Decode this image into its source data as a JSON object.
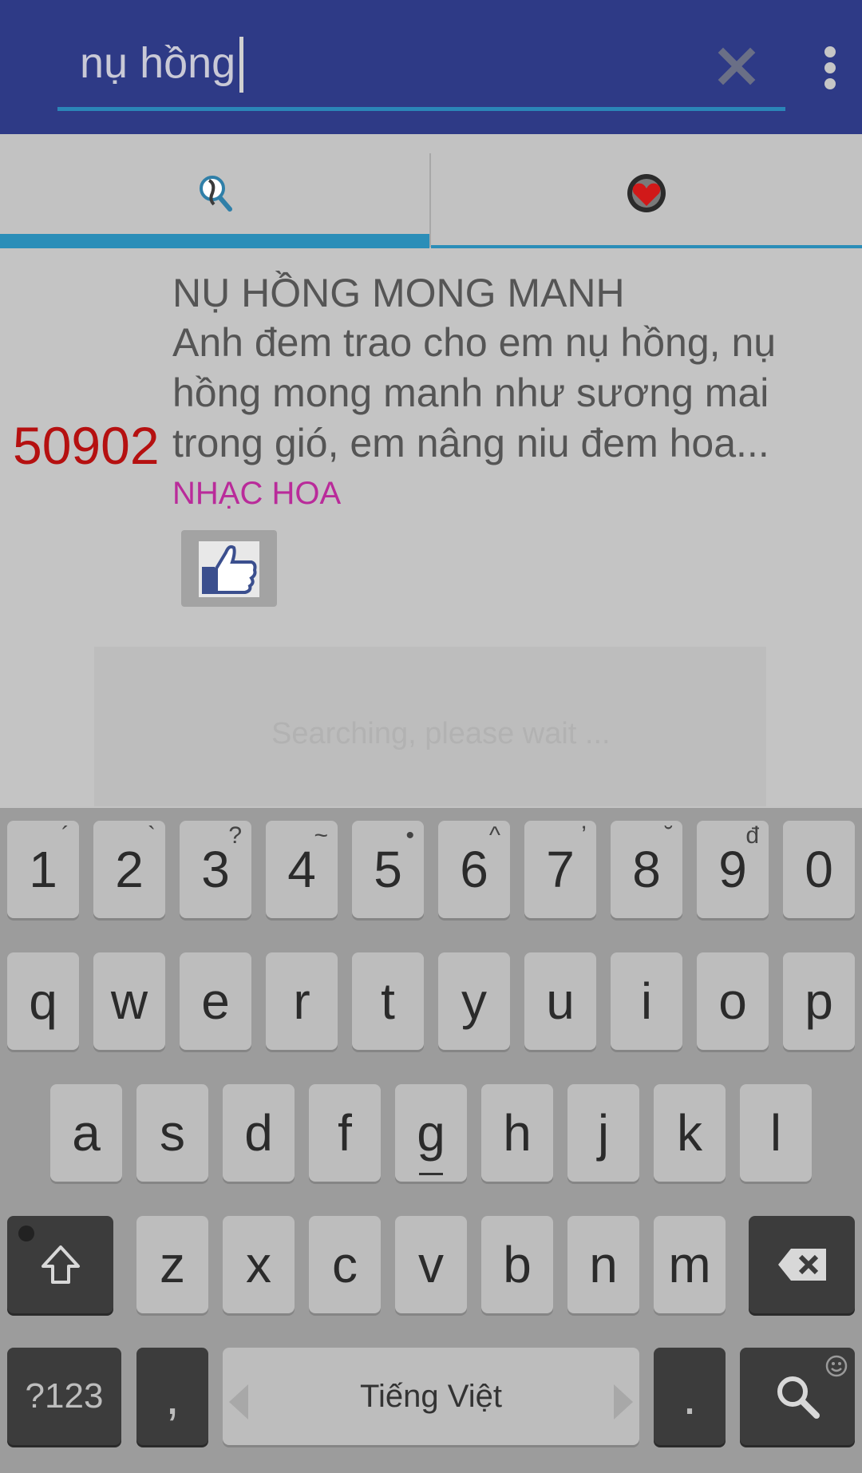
{
  "search": {
    "query": "nụ hồng",
    "clear_icon": "close-icon",
    "menu_icon": "more-vert-icon"
  },
  "tabs": [
    {
      "icon": "search-person-icon",
      "selected": true
    },
    {
      "icon": "heart-icon",
      "selected": false
    }
  ],
  "result": {
    "number": "50902",
    "title": "NỤ HỒNG MONG MANH",
    "lyrics": "Anh đem trao cho em nụ hồng, nụ hồng mong manh như sương mai trong gió, em nâng niu đem hoa...",
    "category": "NHẠC HOA",
    "like_icon": "thumbs-up-icon"
  },
  "dialog": {
    "message": "Searching, please wait ..."
  },
  "keyboard": {
    "row1": [
      {
        "key": "1",
        "hint": "´"
      },
      {
        "key": "2",
        "hint": "`"
      },
      {
        "key": "3",
        "hint": "?"
      },
      {
        "key": "4",
        "hint": "~"
      },
      {
        "key": "5",
        "hint": "•"
      },
      {
        "key": "6",
        "hint": "^"
      },
      {
        "key": "7",
        "hint": "ʼ"
      },
      {
        "key": "8",
        "hint": "˘"
      },
      {
        "key": "9",
        "hint": "đ"
      },
      {
        "key": "0",
        "hint": ""
      }
    ],
    "row2": [
      "q",
      "w",
      "e",
      "r",
      "t",
      "y",
      "u",
      "i",
      "o",
      "p"
    ],
    "row3": [
      "a",
      "s",
      "d",
      "f",
      "g",
      "h",
      "j",
      "k",
      "l"
    ],
    "row4": [
      "z",
      "x",
      "c",
      "v",
      "b",
      "n",
      "m"
    ],
    "symbols_label": "?123",
    "comma_label": ",",
    "space_label": "Tiếng Việt",
    "period_label": ".",
    "shift_icon": "shift-icon",
    "backspace_icon": "backspace-icon",
    "search_key_icon": "search-icon"
  },
  "colors": {
    "appbar": "#2e3a86",
    "accent": "#2b8eb8",
    "number": "#b51010",
    "category": "#b92b9a"
  }
}
